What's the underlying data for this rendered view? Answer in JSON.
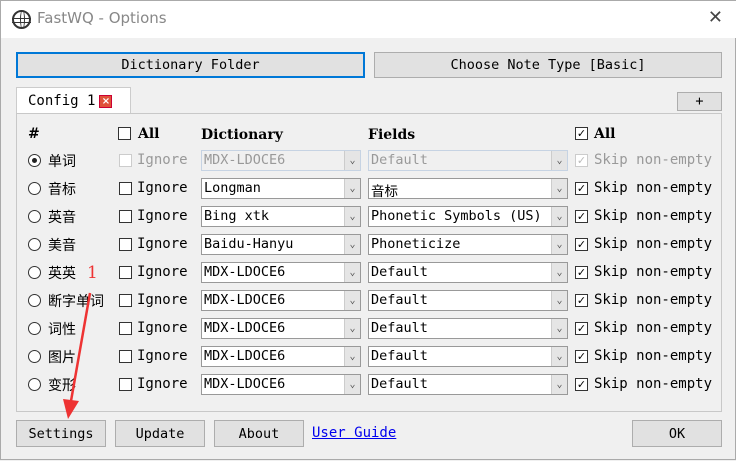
{
  "window": {
    "title": "FastWQ - Options",
    "close": "✕"
  },
  "top_buttons": {
    "dictionary_folder": "Dictionary Folder",
    "note_type": "Choose Note Type [Basic]"
  },
  "tabs": [
    {
      "label": "Config 1",
      "close": "×"
    }
  ],
  "add_tab": "+",
  "headers": {
    "num": "#",
    "all_ignore": "All",
    "dictionary": "Dictionary",
    "fields": "Fields",
    "all_skip": "All",
    "all_skip_checked": true
  },
  "rows": [
    {
      "word": "单词",
      "selected": true,
      "ignore": "Ignore",
      "dictionary": "MDX-LDOCE6",
      "field": "Default",
      "skip": "Skip non-empty",
      "disabled": true
    },
    {
      "word": "音标",
      "ignore": "Ignore",
      "dictionary": "Longman",
      "field": "音标",
      "skip": "Skip non-empty"
    },
    {
      "word": "英音",
      "ignore": "Ignore",
      "dictionary": "Bing xtk",
      "field": "Phonetic Symbols (US)",
      "skip": "Skip non-empty"
    },
    {
      "word": "美音",
      "ignore": "Ignore",
      "dictionary": "Baidu-Hanyu",
      "field": "Phoneticize",
      "skip": "Skip non-empty"
    },
    {
      "word": "英英",
      "ignore": "Ignore",
      "dictionary": "MDX-LDOCE6",
      "field": "Default",
      "skip": "Skip non-empty"
    },
    {
      "word": "断字单词",
      "ignore": "Ignore",
      "dictionary": "MDX-LDOCE6",
      "field": "Default",
      "skip": "Skip non-empty"
    },
    {
      "word": "词性",
      "ignore": "Ignore",
      "dictionary": "MDX-LDOCE6",
      "field": "Default",
      "skip": "Skip non-empty"
    },
    {
      "word": "图片",
      "ignore": "Ignore",
      "dictionary": "MDX-LDOCE6",
      "field": "Default",
      "skip": "Skip non-empty"
    },
    {
      "word": "变形",
      "ignore": "Ignore",
      "dictionary": "MDX-LDOCE6",
      "field": "Default",
      "skip": "Skip non-empty"
    }
  ],
  "bottom": {
    "settings": "Settings",
    "update": "Update",
    "about": "About",
    "user_guide": "User Guide",
    "ok": "OK"
  },
  "annotation": {
    "label": "1",
    "color": "#ee3333"
  }
}
